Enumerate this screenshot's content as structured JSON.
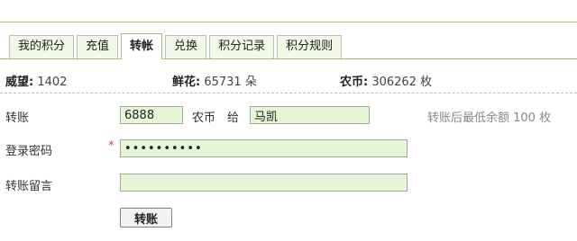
{
  "tabs": [
    "我的积分",
    "充值",
    "转帐",
    "兑换",
    "积分记录",
    "积分规则"
  ],
  "stats": {
    "reputation": {
      "label": "威望:",
      "value": "1402"
    },
    "flowers": {
      "label": "鲜花:",
      "value": "65731",
      "unit": "朵"
    },
    "coins": {
      "label": "农币:",
      "value": "306262",
      "unit": "枚"
    }
  },
  "form": {
    "transfer": {
      "label": "转账",
      "amount": "6888",
      "currency": "农币",
      "to_word": "给",
      "recipient": "马凯",
      "hint": "转账后最低余额 100 枚"
    },
    "password": {
      "label": "登录密码",
      "required_mark": "*",
      "value": "••••••••••"
    },
    "message": {
      "label": "转账留言",
      "value": ""
    },
    "submit_label": "转账"
  }
}
